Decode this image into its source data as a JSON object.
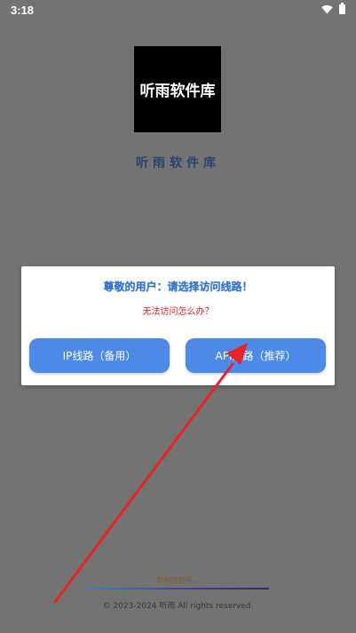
{
  "status_bar": {
    "time": "3:18",
    "icons": [
      "wifi-icon",
      "battery-icon"
    ]
  },
  "app": {
    "logo_text": "听雨软件库",
    "title": "听雨软件库"
  },
  "dialog": {
    "title": "尊敬的用户：请选择访问线路！",
    "help_link": "无法访问怎么办？",
    "buttons": {
      "ip_label": "IP线路（备用）",
      "api_label": "API线路（推荐）"
    }
  },
  "footer": {
    "loading": "数据加载中...",
    "copyright": "© 2023-2024 听雨 All rights reserved."
  },
  "colors": {
    "overlay_bg": "#737373",
    "button": "#4d8ae8",
    "dialog_title": "#2f6fd6",
    "help_text": "#e0141a",
    "annotation_arrow": "#e8242a"
  }
}
